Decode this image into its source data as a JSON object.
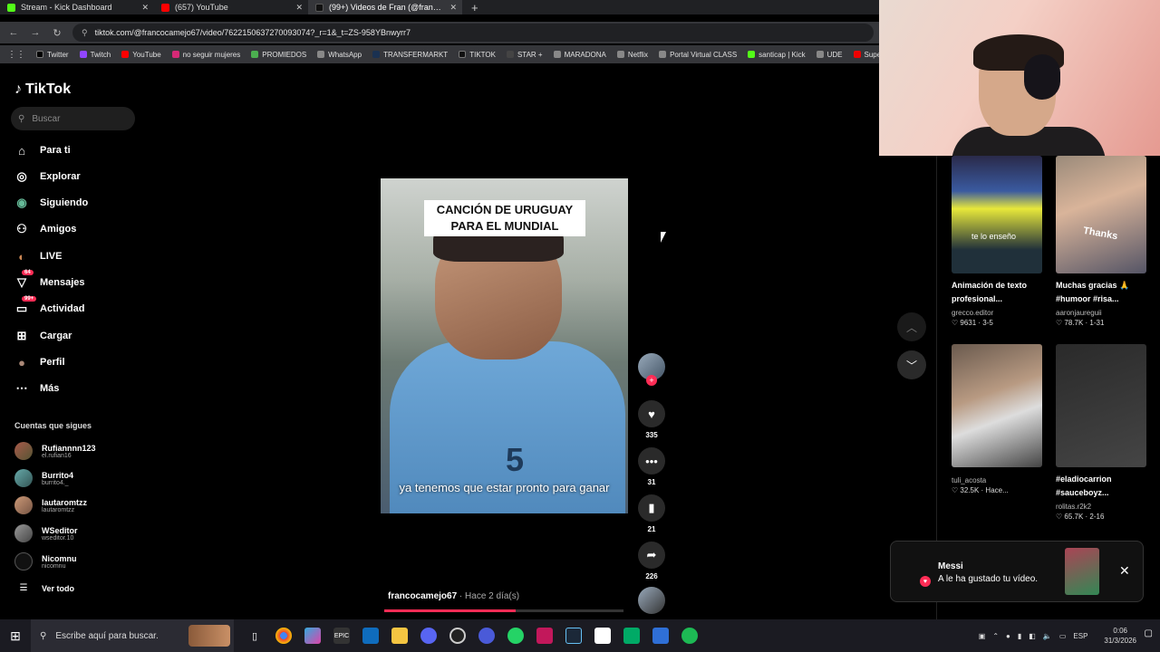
{
  "browser": {
    "tabs": [
      {
        "label": "Stream - Kick Dashboard",
        "color": "#53fc18"
      },
      {
        "label": "(657) YouTube",
        "color": "#ff0000"
      },
      {
        "label": "(99+) Videos de Fran (@fran…",
        "color": "#111111"
      }
    ],
    "url": "tiktok.com/@francocamejo67/video/7622150637270093074?_r=1&_t=ZS-958YBnwyrr7",
    "bookmarks": [
      "Twitter",
      "Twitch",
      "YouTube",
      "no seguir mujeres",
      "PROMIEDOS",
      "WhatsApp",
      "TRANSFERMARKT",
      "TIKTOK",
      "STAR +",
      "MARADONA",
      "Netflix",
      "Portal Virtual CLASS",
      "santicap | Kick",
      "UDE",
      "Supe"
    ]
  },
  "sidebar": {
    "logo": "TikTok",
    "search_placeholder": "Buscar",
    "items": [
      {
        "label": "Para ti",
        "icon": "⌂"
      },
      {
        "label": "Explorar",
        "icon": "◎"
      },
      {
        "label": "Siguiendo",
        "icon": "◉"
      },
      {
        "label": "Amigos",
        "icon": "⚇"
      },
      {
        "label": "LIVE",
        "icon": "◐"
      },
      {
        "label": "Mensajes",
        "icon": "▽",
        "badge": "64"
      },
      {
        "label": "Actividad",
        "icon": "▭",
        "badge": "99+"
      },
      {
        "label": "Cargar",
        "icon": "⊞"
      },
      {
        "label": "Perfil",
        "icon": "●"
      },
      {
        "label": "Más",
        "icon": "⋯"
      }
    ],
    "following_title": "Cuentas que sigues",
    "following": [
      {
        "name": "Rufiannnn123",
        "handle": "el.rufian16"
      },
      {
        "name": "Burrito4",
        "handle": "burrito4._"
      },
      {
        "name": "lautaromtzz",
        "handle": "lautaromtzz"
      },
      {
        "name": "WSeditor",
        "handle": "wseditor.10"
      },
      {
        "name": "Nicomnu",
        "handle": "nicomnu"
      }
    ],
    "see_all": "Ver todo"
  },
  "video": {
    "top_caption": "CANCIÓN DE URUGUAY PARA EL MUNDIAL",
    "subtitle": "ya tenemos que estar pronto para ganar",
    "shirt_number": "5",
    "author": "francocamejo67",
    "ago": " · Hace 2 día(s)",
    "progress": 0.55
  },
  "actions": {
    "likes": "335",
    "comments": "31",
    "saves": "21",
    "shares": "226"
  },
  "grid": [
    {
      "title": "Animación de texto profesional...",
      "user": "grecco.editor",
      "stats": "♡ 9631 · 3-5",
      "overlay": "te lo enseño",
      "colors": [
        "#2a2a4a",
        "#e8e83a"
      ]
    },
    {
      "title": "Muchas gracias 🙏 #humoor #risa...",
      "user": "aaronjaureguii",
      "stats": "♡ 78.7K · 1-31",
      "overlay": "Thanks",
      "colors": [
        "#9a8a7a",
        "#d9b49a"
      ]
    },
    {
      "title": "",
      "user": "tuli_acosta",
      "stats": "♡ 32.5K · Hace...",
      "overlay": "",
      "colors": [
        "#6a5a4e",
        "#b89a82"
      ]
    },
    {
      "title": "#eladiocarrion #sauceboyz...",
      "user": "rolitas.r2k2",
      "stats": "♡ 65.7K · 2-16",
      "overlay": "",
      "colors": [
        "#2a2a2a",
        "#454545"
      ]
    }
  ],
  "toast": {
    "title": "Messi",
    "message": "A le ha gustado tu vídeo."
  },
  "taskbar": {
    "search_placeholder": "Escribe aquí para buscar.",
    "lang": "ESP",
    "time": "0:06",
    "date": "31/3/2026"
  }
}
